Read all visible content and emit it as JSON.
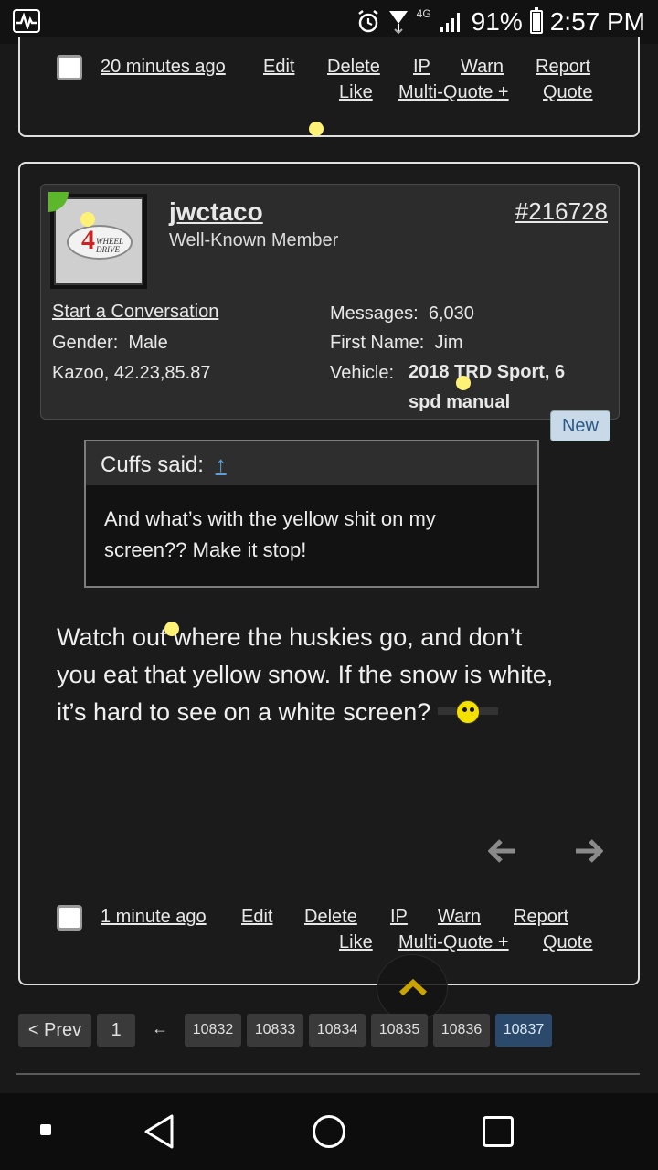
{
  "status_bar": {
    "network": "4G",
    "battery": "91%",
    "time": "2:57 PM"
  },
  "post_top": {
    "time": "20 minutes ago",
    "actions": [
      "Edit",
      "Delete",
      "IP",
      "Warn",
      "Report"
    ],
    "actions_row2": [
      "Like",
      "Multi-Quote +",
      "Quote"
    ]
  },
  "post_main": {
    "username": "jwctaco",
    "user_title": "Well-Known Member",
    "post_number": "#216728",
    "avatar": {
      "big_letter": "4",
      "line1": "WHEEL",
      "line2": "DRIVE"
    },
    "start_conversation": "Start a Conversation",
    "gender_label": "Gender:",
    "gender": "Male",
    "location": "Kazoo, 42.23,85.87",
    "messages_label": "Messages:",
    "messages": "6,030",
    "first_name_label": "First Name:",
    "first_name": "Jim",
    "vehicle_label": "Vehicle:",
    "vehicle": "2018 TRD Sport, 6 spd manual",
    "new_badge": "New",
    "quote": {
      "author": "Cuffs said:",
      "arrow": "↑",
      "text": "And what’s with the yellow shit on my screen?? Make it stop!"
    },
    "message": "Watch out where the huskies go, and don’t you eat that yellow snow. If the snow is white, it’s hard to see on a white screen?",
    "time": "1 minute ago",
    "actions": [
      "Edit",
      "Delete",
      "IP",
      "Warn",
      "Report"
    ],
    "actions_row2": [
      "Like",
      "Multi-Quote +",
      "Quote"
    ]
  },
  "pagination": {
    "prev": "< Prev",
    "first": "1",
    "ellipsis_arrow": "←",
    "pages": [
      "10832",
      "10833",
      "10834",
      "10835",
      "10836",
      "10837"
    ],
    "current": "10837"
  }
}
